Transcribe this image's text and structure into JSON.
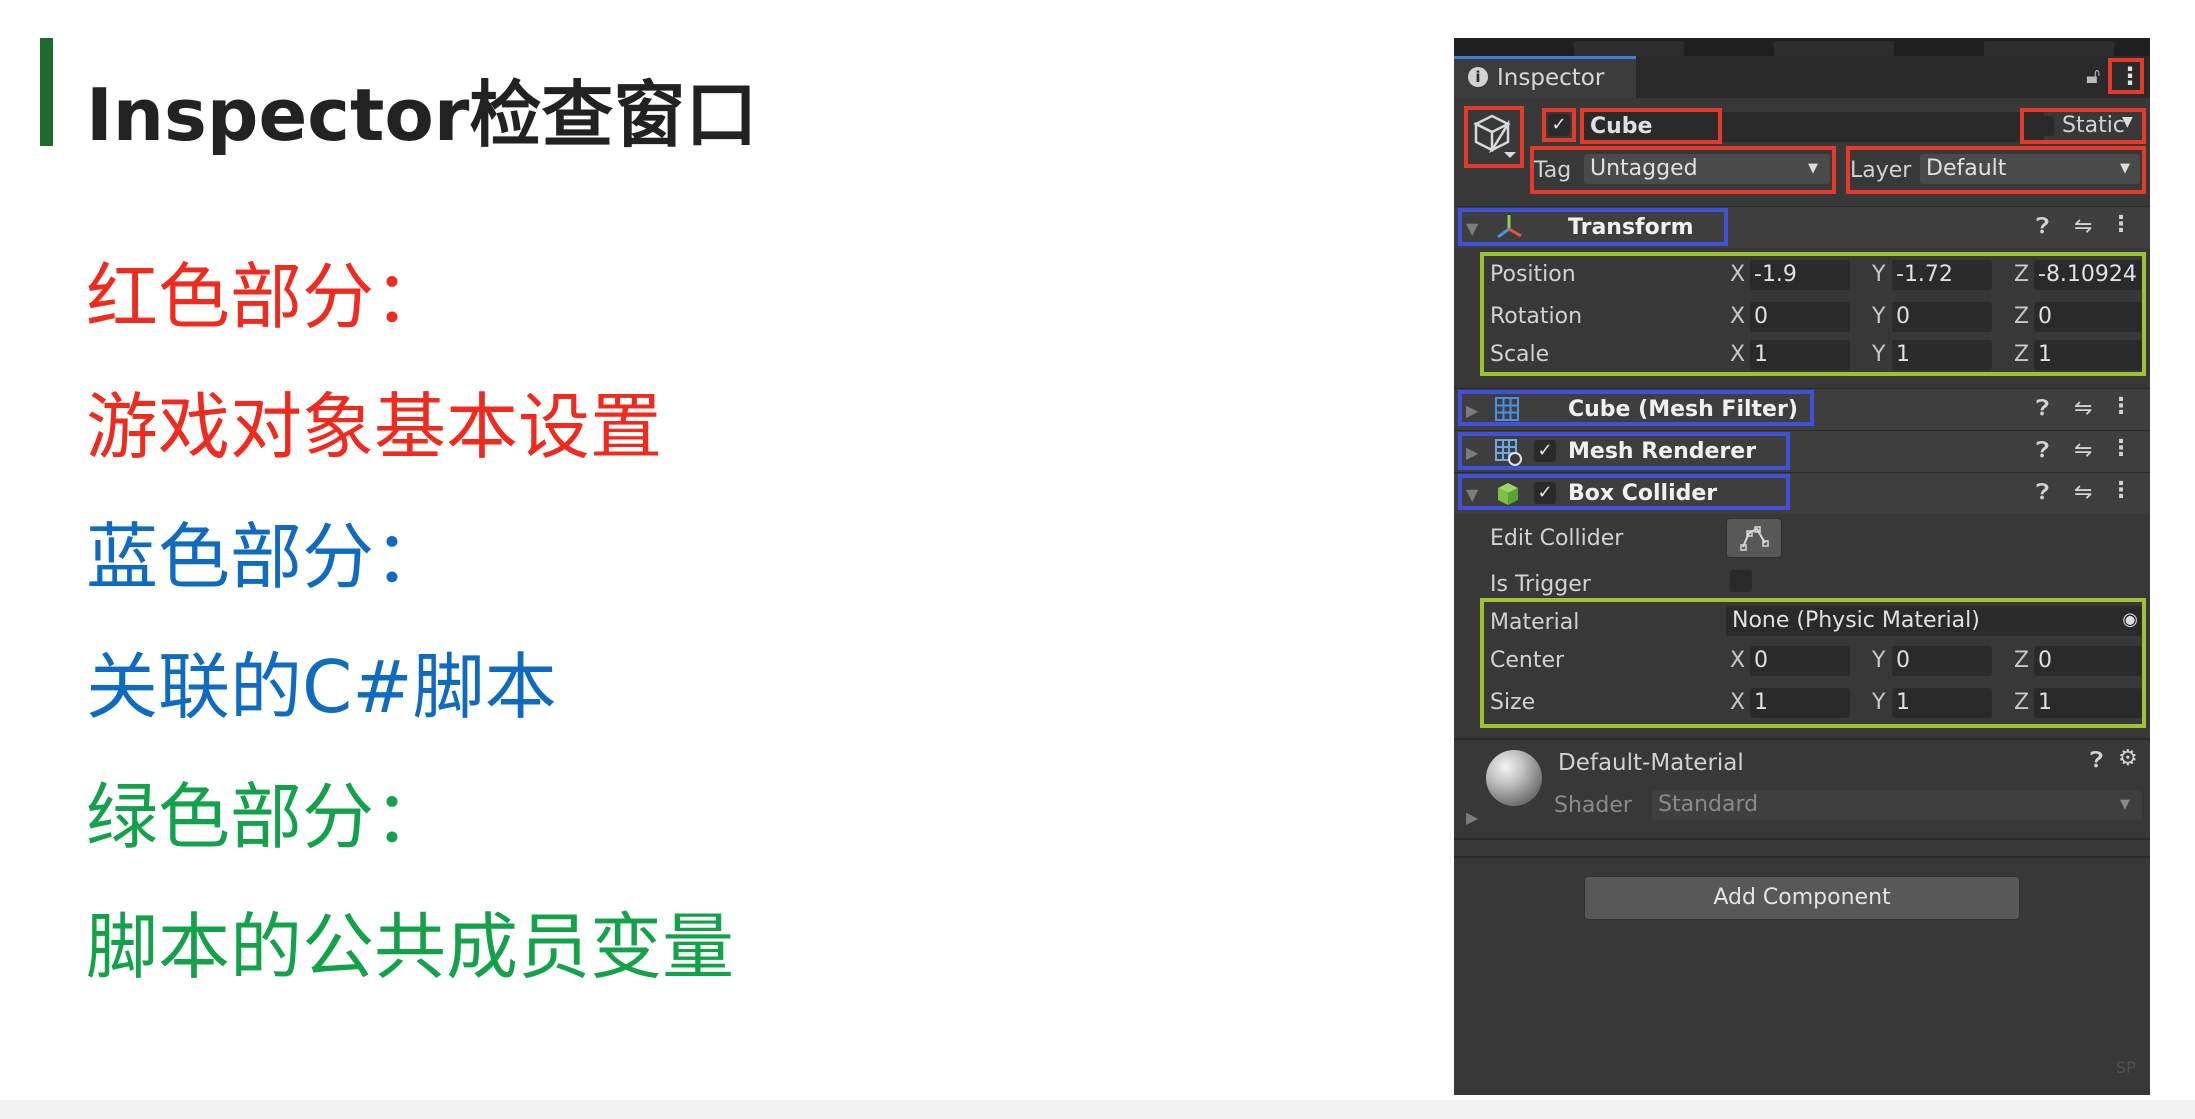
{
  "slide": {
    "title": "Inspector检查窗口",
    "lines": [
      {
        "text": "红色部分：",
        "color": "#ee2b1e"
      },
      {
        "text": "游戏对象基本设置",
        "color": "#ee2b1e"
      },
      {
        "text": "蓝色部分：",
        "color": "#0f6bbf"
      },
      {
        "text": "关联的C#脚本",
        "color": "#0f6bbf"
      },
      {
        "text": "绿色部分：",
        "color": "#13a14a"
      },
      {
        "text": "脚本的公共成员变量",
        "color": "#13a14a"
      }
    ]
  },
  "inspector": {
    "tab_label": "Inspector",
    "object": {
      "active": true,
      "name": "Cube",
      "static_label": "Static",
      "tag_label": "Tag",
      "tag_value": "Untagged",
      "layer_label": "Layer",
      "layer_value": "Default"
    },
    "transform": {
      "title": "Transform",
      "rows": [
        {
          "label": "Position",
          "x": "-1.9",
          "y": "-1.72",
          "z": "-8.10924"
        },
        {
          "label": "Rotation",
          "x": "0",
          "y": "0",
          "z": "0"
        },
        {
          "label": "Scale",
          "x": "1",
          "y": "1",
          "z": "1"
        }
      ]
    },
    "mesh_filter": {
      "title": "Cube (Mesh Filter)"
    },
    "mesh_renderer": {
      "title": "Mesh Renderer",
      "enabled": true
    },
    "box_collider": {
      "title": "Box Collider",
      "enabled": true,
      "edit_collider_label": "Edit Collider",
      "is_trigger_label": "Is Trigger",
      "is_trigger": false,
      "material_label": "Material",
      "material_value": "None (Physic Material)",
      "center": {
        "label": "Center",
        "x": "0",
        "y": "0",
        "z": "0"
      },
      "size": {
        "label": "Size",
        "x": "1",
        "y": "1",
        "z": "1"
      }
    },
    "material": {
      "name": "Default-Material",
      "shader_label": "Shader",
      "shader_value": "Standard"
    },
    "add_component_label": "Add Component",
    "axes": {
      "x": "X",
      "y": "Y",
      "z": "Z"
    },
    "watermark": "SP"
  },
  "highlight_colors": {
    "red": "#e33a2b",
    "blue": "#3f51d6",
    "green": "#9dc234"
  }
}
